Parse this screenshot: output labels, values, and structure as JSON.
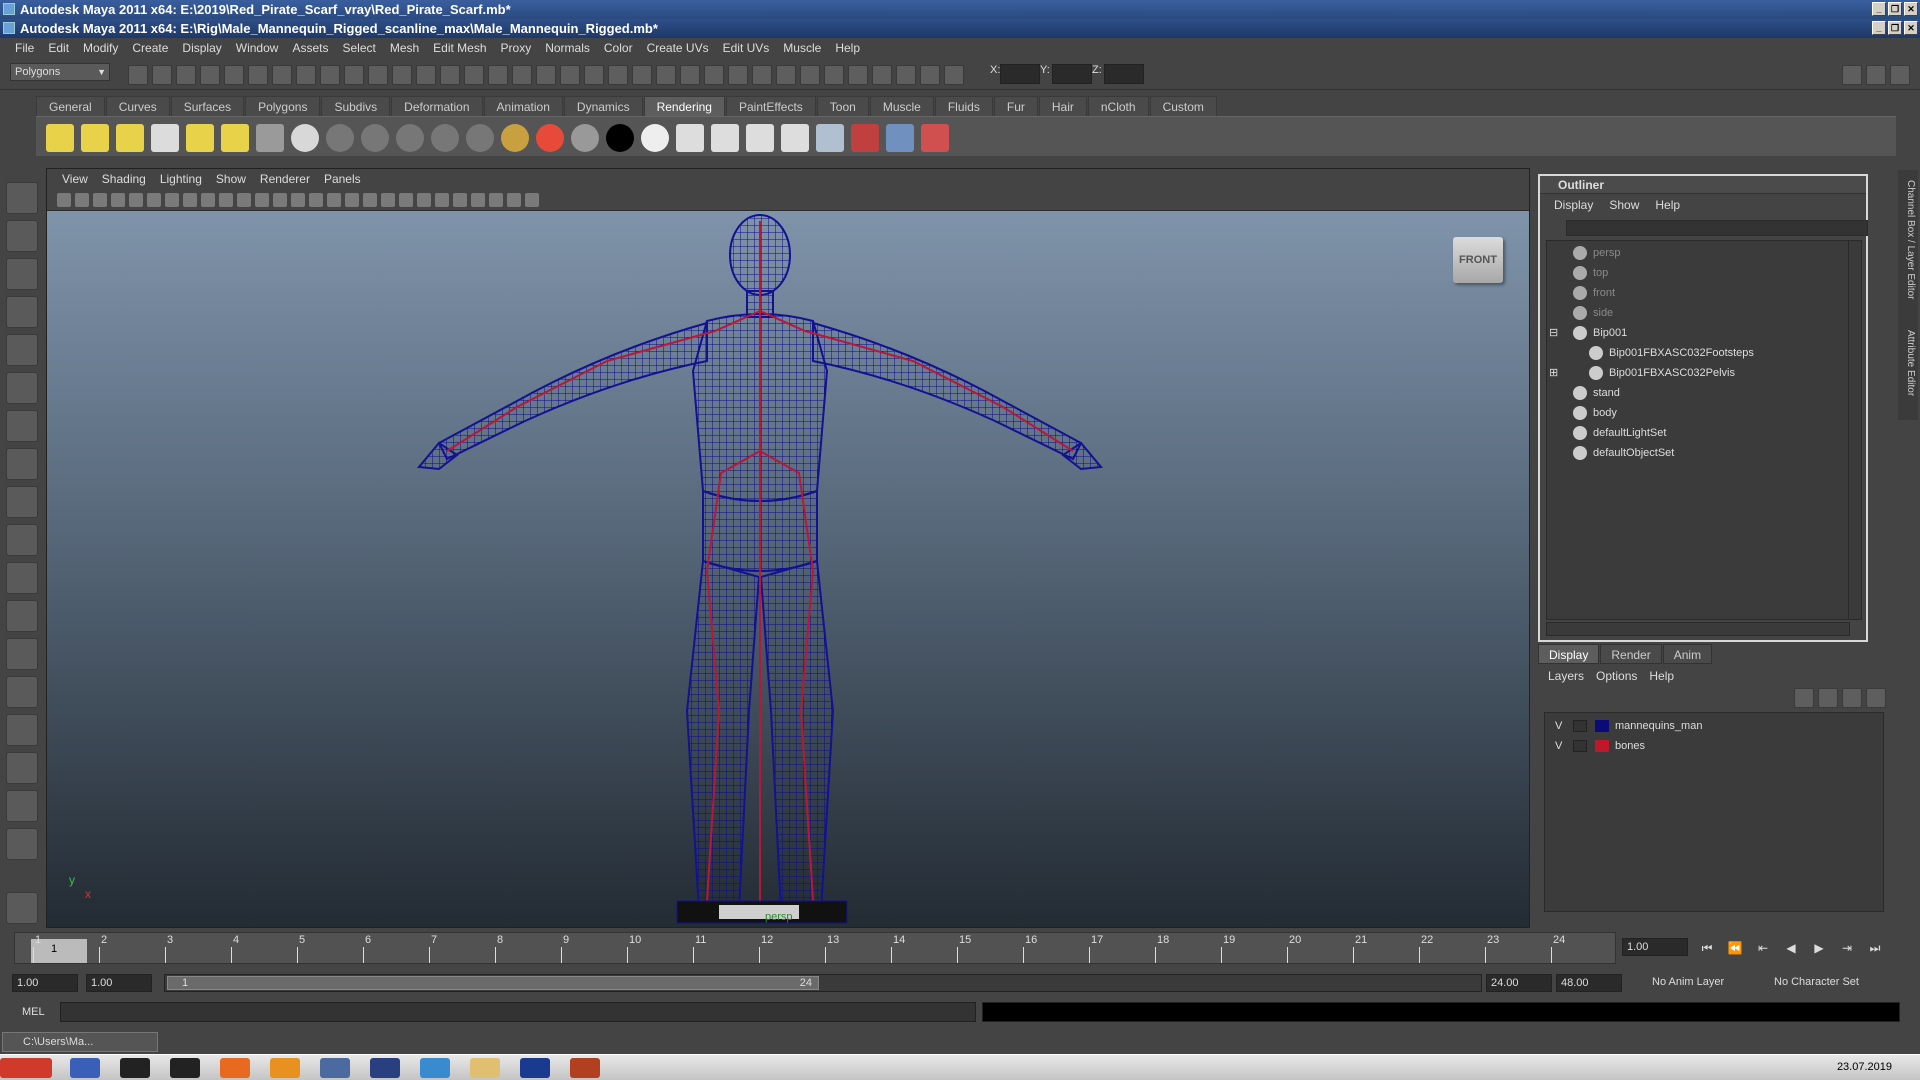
{
  "window": {
    "outer_title": "Autodesk Maya 2011 x64: E:\\2019\\Red_Pirate_Scarf_vray\\Red_Pirate_Scarf.mb*",
    "inner_title": "Autodesk Maya 2011 x64: E:\\Rig\\Male_Mannequin_Rigged_scanline_max\\Male_Mannequin_Rigged.mb*"
  },
  "menubar": [
    "File",
    "Edit",
    "Modify",
    "Create",
    "Display",
    "Window",
    "Assets",
    "Select",
    "Mesh",
    "Edit Mesh",
    "Proxy",
    "Normals",
    "Color",
    "Create UVs",
    "Edit UVs",
    "Muscle",
    "Help"
  ],
  "status_line": {
    "mode": "Polygons",
    "x_label": "X:",
    "y_label": "Y:",
    "z_label": "Z:"
  },
  "shelf_tabs": [
    "General",
    "Curves",
    "Surfaces",
    "Polygons",
    "Subdivs",
    "Deformation",
    "Animation",
    "Dynamics",
    "Rendering",
    "PaintEffects",
    "Toon",
    "Muscle",
    "Fluids",
    "Fur",
    "Hair",
    "nCloth",
    "Custom"
  ],
  "shelf_active": "Rendering",
  "viewport": {
    "menu": [
      "View",
      "Shading",
      "Lighting",
      "Show",
      "Renderer",
      "Panels"
    ],
    "view_cube": "FRONT",
    "camera": "persp",
    "axis_y": "y",
    "axis_x": "x"
  },
  "outliner": {
    "title": "Outliner",
    "menu": [
      "Display",
      "Show",
      "Help"
    ],
    "items": [
      {
        "label": "persp",
        "dim": true
      },
      {
        "label": "top",
        "dim": true
      },
      {
        "label": "front",
        "dim": true
      },
      {
        "label": "side",
        "dim": true
      },
      {
        "label": "Bip001",
        "dim": false
      },
      {
        "label": "Bip001FBXASC032Footsteps",
        "dim": false
      },
      {
        "label": "Bip001FBXASC032Pelvis",
        "dim": false
      },
      {
        "label": "stand",
        "dim": false
      },
      {
        "label": "body",
        "dim": false
      },
      {
        "label": "defaultLightSet",
        "dim": false
      },
      {
        "label": "defaultObjectSet",
        "dim": false
      }
    ]
  },
  "layer_editor": {
    "tabs": [
      "Display",
      "Render",
      "Anim"
    ],
    "menu": [
      "Layers",
      "Options",
      "Help"
    ],
    "layers": [
      {
        "v": "V",
        "name": "mannequins_man",
        "color": "#0a0a78"
      },
      {
        "v": "V",
        "name": "bones",
        "color": "#c0182a"
      }
    ]
  },
  "side_tabs": [
    "Channel Box / Layer Editor",
    "Attribute Editor"
  ],
  "timeline": {
    "ticks": [
      "1",
      "2",
      "3",
      "4",
      "5",
      "6",
      "7",
      "8",
      "9",
      "10",
      "11",
      "12",
      "13",
      "14",
      "15",
      "16",
      "17",
      "18",
      "19",
      "20",
      "21",
      "22",
      "23",
      "24"
    ],
    "current_frame": "1",
    "current_field": "1.00"
  },
  "range": {
    "start": "1.00",
    "start2": "1.00",
    "slider_start": "1",
    "slider_end": "24",
    "end": "24.00",
    "end2": "48.00",
    "anim_layer": "No Anim Layer",
    "char_set": "No Character Set"
  },
  "mel_label": "MEL",
  "minimized_window": "C:\\Users\\Ma...",
  "clock": "23.07.2019"
}
